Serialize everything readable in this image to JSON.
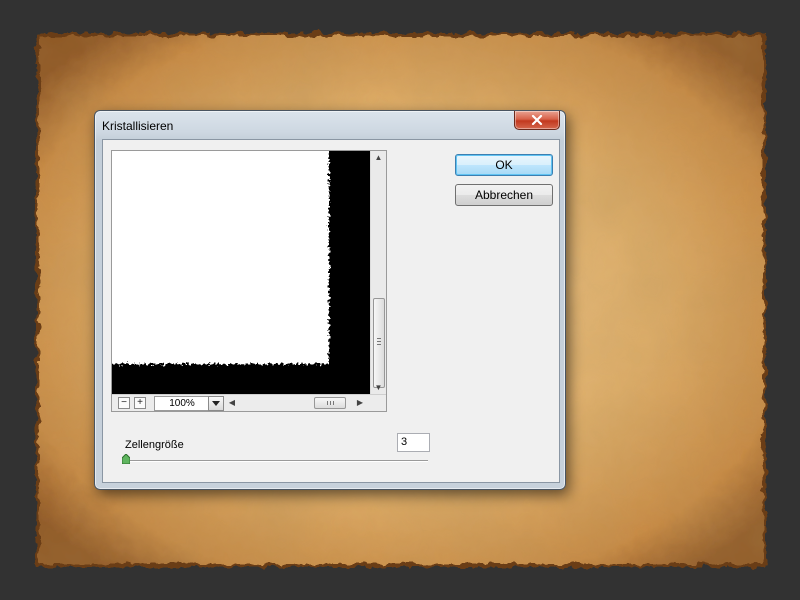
{
  "window": {
    "title": "Kristallisieren",
    "close_label": "✕"
  },
  "buttons": {
    "ok_label": "OK",
    "cancel_label": "Abbrechen"
  },
  "preview": {
    "zoom_out": "−",
    "zoom_in": "+",
    "zoom_level": "100%"
  },
  "parameter": {
    "label": "Zellengröße",
    "value": "3",
    "slider_fraction": 0.0
  },
  "colors": {
    "background": "#323232",
    "parchment": "#d9a55f",
    "default_button_border": "#3c7fb1",
    "close_button": "#c2391f"
  },
  "icons": [
    "close-icon",
    "scroll-up-icon",
    "scroll-down-icon",
    "scroll-left-icon",
    "scroll-right-icon",
    "dropdown-arrow-icon",
    "slider-thumb-icon"
  ]
}
